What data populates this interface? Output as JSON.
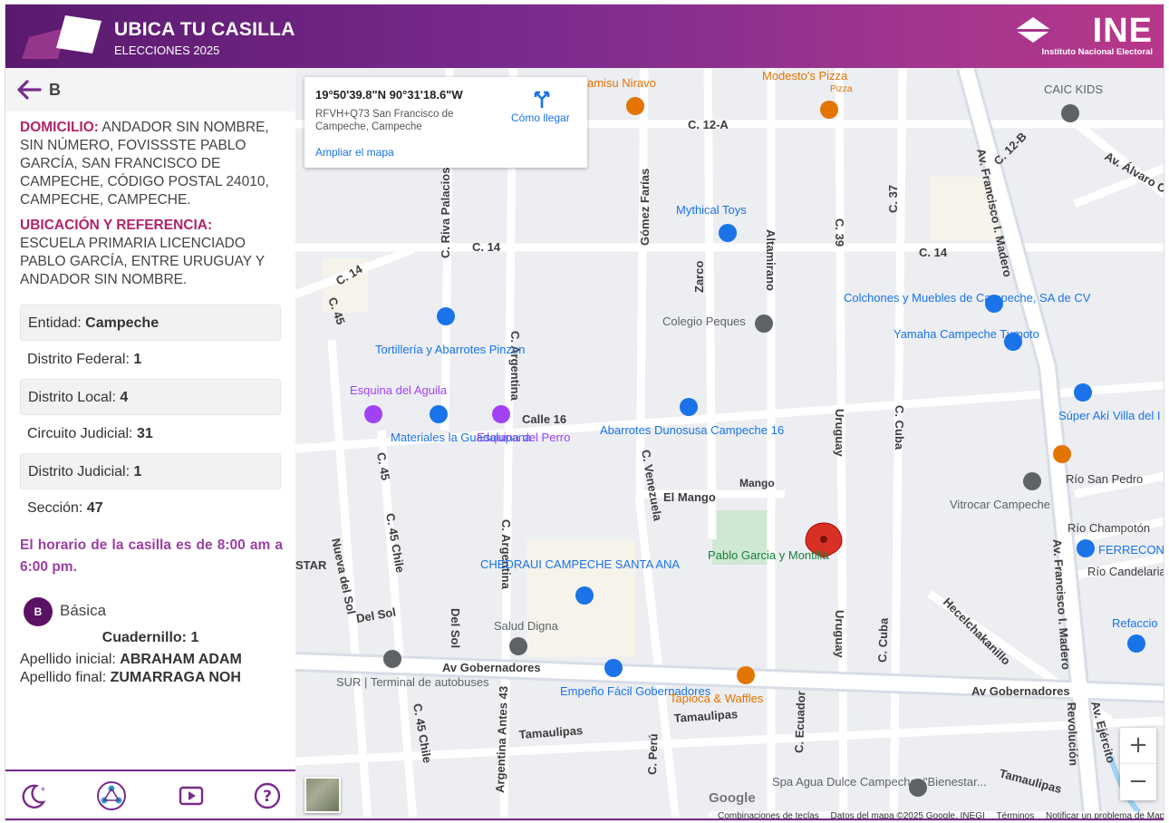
{
  "header": {
    "title": "UBICA TU CASILLA",
    "subtitle": "ELECCIONES 2025",
    "org_logo_text": "INE",
    "org_name": "Instituto Nacional Electoral"
  },
  "sidebar": {
    "back_letter": "B",
    "domicilio_label": "DOMICILIO:",
    "domicilio": "ANDADOR SIN NOMBRE, SIN NÚMERO, FOVISSSTE PABLO GARCÍA, SAN FRANCISCO DE CAMPECHE, CÓDIGO POSTAL 24010, CAMPECHE, CAMPECHE.",
    "ubicacion_label": "UBICACIÓN Y REFERENCIA:",
    "ubicacion": "ESCUELA PRIMARIA LICENCIADO PABLO GARCÍA, ENTRE URUGUAY Y ANDADOR SIN NOMBRE.",
    "info": [
      {
        "label": "Entidad:",
        "value": "Campeche"
      },
      {
        "label": "Distrito Federal:",
        "value": "1"
      },
      {
        "label": "Distrito Local:",
        "value": "4"
      },
      {
        "label": "Circuito Judicial:",
        "value": "31"
      },
      {
        "label": "Distrito Judicial:",
        "value": "1"
      },
      {
        "label": "Sección:",
        "value": "47"
      }
    ],
    "horario": "El horario de la casilla es de 8:00 am a 6:00 pm.",
    "casilla_badge": "B",
    "casilla_tipo": "Básica",
    "cuadernillo": "Cuadernillo: 1",
    "apellido_inicial_label": "Apellido inicial:",
    "apellido_inicial": "ABRAHAM ADAM",
    "apellido_final_label": "Apellido final:",
    "apellido_final": "ZUMARRAGA NOH"
  },
  "bottom_icons": [
    "moon-icon",
    "network-icon",
    "play-icon",
    "help-icon"
  ],
  "map": {
    "coords": "19°50'39.8\"N 90°31'18.6\"W",
    "plus_code": "RFVH+Q73 San Francisco de Campeche, Campeche",
    "directions_label": "Cómo llegar",
    "enlarge_label": "Ampliar el mapa",
    "zoom_in": "+",
    "zoom_out": "−",
    "google": "Google",
    "attribution": [
      "Combinaciones de teclas",
      "Datos del mapa ©2025 Google, INEGI",
      "Términos",
      "Notificar un problema de Maps"
    ],
    "streets": [
      "C. 12-A",
      "C. 14",
      "C. 14",
      "C. 14",
      "Calle 16",
      "Av Gobernadores",
      "Av Gobernadores",
      "Tamaulipas",
      "Tamaulipas",
      "Tamaulipas",
      "C. Riva Palacios",
      "C. Argentina",
      "C. Argentina",
      "Gómez Farías",
      "Zarco",
      "Altamirano",
      "C. 39",
      "C. 37",
      "C. 45",
      "C. 45",
      "C. 45 Chile",
      "C. 45 Chile",
      "Nueva del Sol",
      "Del Sol",
      "Del Sol",
      "Argentina Antes 43",
      "C. Venezuela",
      "C. Perú",
      "C. Ecuador",
      "Uruguay",
      "Uruguay",
      "C. Cuba",
      "C. Cuba",
      "Av. Francisco I. Madero",
      "Av. Francisco I. Madero",
      "Av. Ejército",
      "Revolución",
      "Hecelchakanillo",
      "C. 12-B",
      "Av. Álvaro O",
      "El Mango",
      "Mango",
      "STAR"
    ],
    "pois": [
      {
        "name": "Modesto's Pizza",
        "sub": "Pizza",
        "color": "#e37400"
      },
      {
        "name": "amisu Niravo",
        "color": "#e37400"
      },
      {
        "name": "CAIC KIDS",
        "color": "#5f6368"
      },
      {
        "name": "Mythical Toys",
        "color": "#1a73e8"
      },
      {
        "name": "Colegio Peques",
        "color": "#5f6368"
      },
      {
        "name": "Colchones y Muebles de Campeche, SA de CV",
        "color": "#1a73e8"
      },
      {
        "name": "Yamaha Campeche Tumoto",
        "color": "#1a73e8"
      },
      {
        "name": "Tortillería y Abarrotes Pinzon",
        "color": "#1a73e8"
      },
      {
        "name": "Esquina del Aguila",
        "color": "#a142f4"
      },
      {
        "name": "Materiales la Guadalupana",
        "color": "#1a73e8"
      },
      {
        "name": "Esquina del Perro",
        "color": "#a142f4"
      },
      {
        "name": "Abarrotes Dunosusa Campeche 16",
        "color": "#1a73e8"
      },
      {
        "name": "Súper Akí Villa del I",
        "color": "#1a73e8"
      },
      {
        "name": "Río San Pedro",
        "color": "#3c3c3c"
      },
      {
        "name": "Vitrocar Campeche",
        "color": "#5f6368"
      },
      {
        "name": "Río Champotón",
        "color": "#3c3c3c"
      },
      {
        "name": "FERRECONS",
        "color": "#1a73e8"
      },
      {
        "name": "Río Candelaria",
        "color": "#3c3c3c"
      },
      {
        "name": "Pablo Garcia y Montilla",
        "color": "#188038"
      },
      {
        "name": "CHEDRAUI CAMPECHE SANTA ANA",
        "color": "#1a73e8"
      },
      {
        "name": "Salud Digna",
        "color": "#5f6368"
      },
      {
        "name": "SUR | Terminal de autobuses",
        "color": "#5f6368"
      },
      {
        "name": "Empeño Fácil Gobernadores",
        "color": "#1a73e8"
      },
      {
        "name": "Tapioca & Waffles",
        "color": "#e37400"
      },
      {
        "name": "Refaccio",
        "color": "#1a73e8"
      },
      {
        "name": "Spa Agua Dulce Campeche. \"Bienestar...",
        "color": "#5f6368"
      }
    ]
  },
  "colors": {
    "header_start": "#5a1a6e",
    "header_end": "#b8378a",
    "accent_label": "#b0246a",
    "horario": "#9b3fa3",
    "badge": "#5a1263",
    "pin": "#d93025"
  }
}
